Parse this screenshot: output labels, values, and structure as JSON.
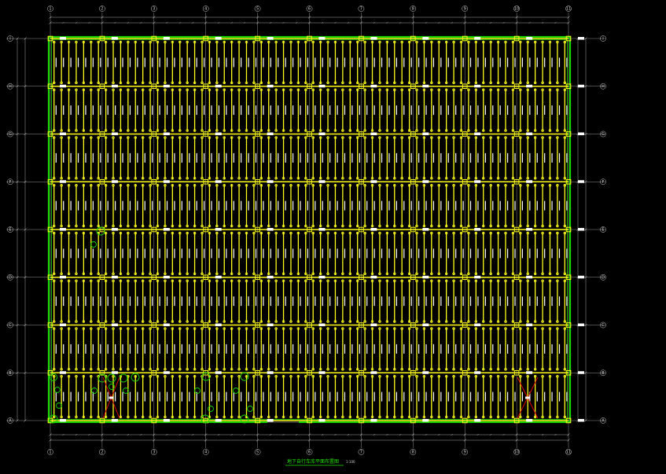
{
  "drawing": {
    "title": "地下自行车库平面布置图",
    "scale": "1:100"
  },
  "axes": {
    "columns": [
      "1",
      "2",
      "3",
      "4",
      "5",
      "6",
      "7",
      "8",
      "9",
      "10",
      "11"
    ],
    "rows": [
      "A",
      "B",
      "C",
      "D",
      "E",
      "F",
      "G",
      "H",
      "I"
    ]
  },
  "colors": {
    "background": "#000000",
    "wall": "#19d600",
    "structure": "#ffff1a",
    "axis_line": "#cfcfcf",
    "cross_mark": "#e00000",
    "text": "#ffffff"
  }
}
